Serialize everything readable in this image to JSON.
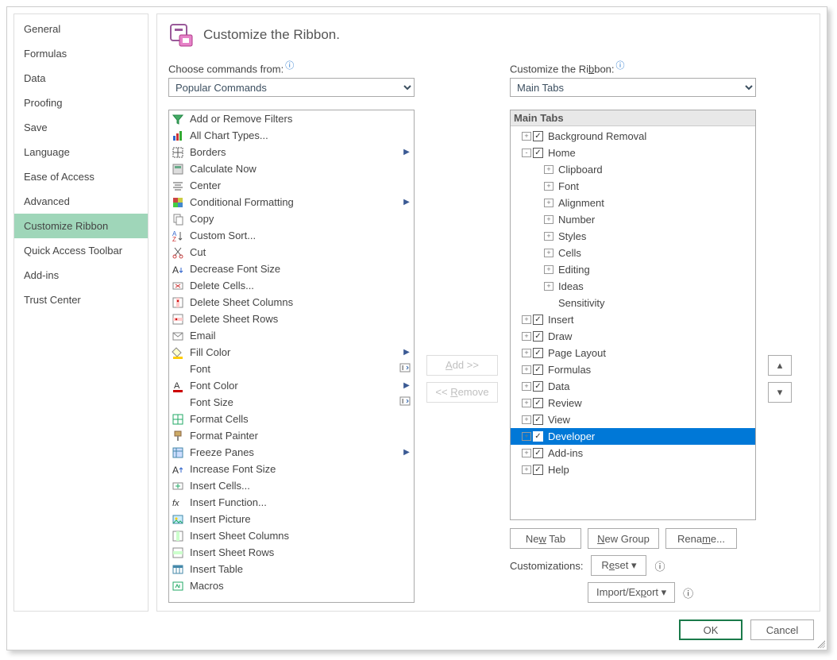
{
  "sidebar": {
    "items": [
      {
        "label": "General",
        "selected": false
      },
      {
        "label": "Formulas",
        "selected": false
      },
      {
        "label": "Data",
        "selected": false
      },
      {
        "label": "Proofing",
        "selected": false
      },
      {
        "label": "Save",
        "selected": false
      },
      {
        "label": "Language",
        "selected": false
      },
      {
        "label": "Ease of Access",
        "selected": false
      },
      {
        "label": "Advanced",
        "selected": false
      },
      {
        "label": "Customize Ribbon",
        "selected": true
      },
      {
        "label": "Quick Access Toolbar",
        "selected": false
      },
      {
        "label": "Add-ins",
        "selected": false
      },
      {
        "label": "Trust Center",
        "selected": false
      }
    ]
  },
  "header": {
    "title": "Customize the Ribbon."
  },
  "left": {
    "label": "Choose commands from:",
    "dropdown": "Popular Commands",
    "commands": [
      {
        "icon": "filter",
        "label": "Add or Remove Filters"
      },
      {
        "icon": "chart",
        "label": "All Chart Types..."
      },
      {
        "icon": "borders",
        "label": "Borders",
        "sub": "arrow"
      },
      {
        "icon": "calc",
        "label": "Calculate Now"
      },
      {
        "icon": "center",
        "label": "Center"
      },
      {
        "icon": "condfmt",
        "label": "Conditional Formatting",
        "sub": "arrow"
      },
      {
        "icon": "copy",
        "label": "Copy"
      },
      {
        "icon": "sort",
        "label": "Custom Sort..."
      },
      {
        "icon": "cut",
        "label": "Cut"
      },
      {
        "icon": "fontdown",
        "label": "Decrease Font Size"
      },
      {
        "icon": "delcell",
        "label": "Delete Cells..."
      },
      {
        "icon": "delcol",
        "label": "Delete Sheet Columns"
      },
      {
        "icon": "delrow",
        "label": "Delete Sheet Rows"
      },
      {
        "icon": "email",
        "label": "Email"
      },
      {
        "icon": "fill",
        "label": "Fill Color",
        "sub": "arrow"
      },
      {
        "icon": "blank",
        "label": "Font",
        "sub": "combo"
      },
      {
        "icon": "fontcolor",
        "label": "Font Color",
        "sub": "arrow"
      },
      {
        "icon": "blank",
        "label": "Font Size",
        "sub": "combo"
      },
      {
        "icon": "fmtcell",
        "label": "Format Cells"
      },
      {
        "icon": "painter",
        "label": "Format Painter"
      },
      {
        "icon": "freeze",
        "label": "Freeze Panes",
        "sub": "arrow"
      },
      {
        "icon": "fontup",
        "label": "Increase Font Size"
      },
      {
        "icon": "inscell",
        "label": "Insert Cells..."
      },
      {
        "icon": "fx",
        "label": "Insert Function..."
      },
      {
        "icon": "pic",
        "label": "Insert Picture"
      },
      {
        "icon": "inscol",
        "label": "Insert Sheet Columns"
      },
      {
        "icon": "insrow",
        "label": "Insert Sheet Rows"
      },
      {
        "icon": "table",
        "label": "Insert Table"
      },
      {
        "icon": "macro",
        "label": "Macros"
      }
    ]
  },
  "middle": {
    "add": "Add >>",
    "remove": "<< Remove"
  },
  "right": {
    "label": "Customize the Ribbon:",
    "dropdown": "Main Tabs",
    "header": "Main Tabs",
    "tree": [
      {
        "level": 1,
        "exp": "+",
        "chk": true,
        "label": "Background Removal"
      },
      {
        "level": 1,
        "exp": "-",
        "chk": true,
        "label": "Home"
      },
      {
        "level": 2,
        "exp": "+",
        "label": "Clipboard"
      },
      {
        "level": 2,
        "exp": "+",
        "label": "Font"
      },
      {
        "level": 2,
        "exp": "+",
        "label": "Alignment"
      },
      {
        "level": 2,
        "exp": "+",
        "label": "Number"
      },
      {
        "level": 2,
        "exp": "+",
        "label": "Styles"
      },
      {
        "level": 2,
        "exp": "+",
        "label": "Cells"
      },
      {
        "level": 2,
        "exp": "+",
        "label": "Editing"
      },
      {
        "level": 2,
        "exp": "+",
        "label": "Ideas"
      },
      {
        "level": 2,
        "exp": "",
        "label": "Sensitivity"
      },
      {
        "level": 1,
        "exp": "+",
        "chk": true,
        "label": "Insert"
      },
      {
        "level": 1,
        "exp": "+",
        "chk": true,
        "label": "Draw"
      },
      {
        "level": 1,
        "exp": "+",
        "chk": true,
        "label": "Page Layout"
      },
      {
        "level": 1,
        "exp": "+",
        "chk": true,
        "label": "Formulas"
      },
      {
        "level": 1,
        "exp": "+",
        "chk": true,
        "label": "Data"
      },
      {
        "level": 1,
        "exp": "+",
        "chk": true,
        "label": "Review"
      },
      {
        "level": 1,
        "exp": "+",
        "chk": true,
        "label": "View"
      },
      {
        "level": 1,
        "exp": "+",
        "chk": true,
        "label": "Developer",
        "selected": true
      },
      {
        "level": 1,
        "exp": "+",
        "chk": true,
        "label": "Add-ins"
      },
      {
        "level": 1,
        "exp": "+",
        "chk": true,
        "label": "Help"
      }
    ],
    "buttons": {
      "newtab": "New Tab",
      "newgroup": "New Group",
      "rename": "Rename..."
    },
    "customizations_label": "Customizations:",
    "reset": "Reset",
    "importexport": "Import/Export"
  },
  "footer": {
    "ok": "OK",
    "cancel": "Cancel"
  }
}
